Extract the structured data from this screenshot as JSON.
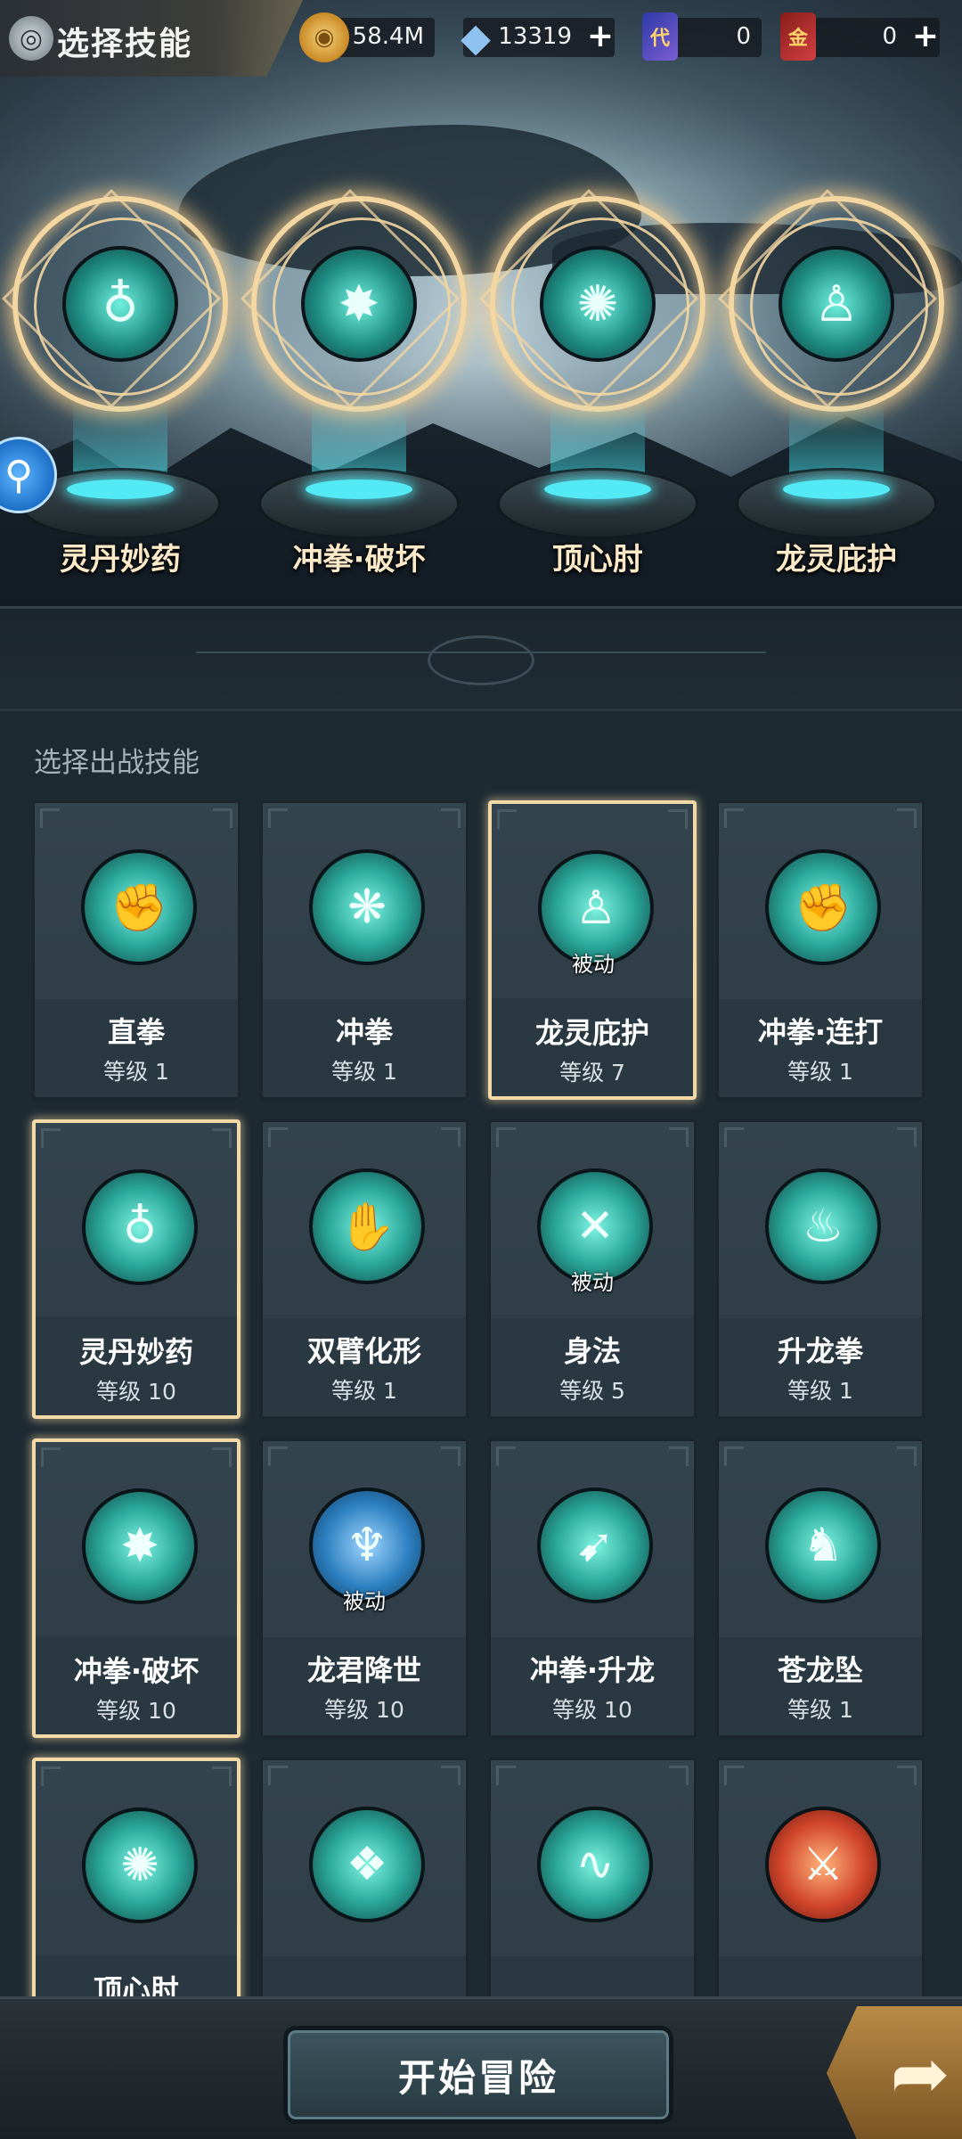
{
  "header": {
    "title": "选择技能",
    "resources": [
      {
        "name": "gold",
        "value": "58.4M",
        "icon": "coin-icon"
      },
      {
        "name": "crystal",
        "value": "13319",
        "icon": "crystal-icon",
        "addable": true
      },
      {
        "name": "token_dai",
        "value": "0",
        "icon_label": "代",
        "icon": "voucher-icon"
      },
      {
        "name": "token_jin",
        "value": "0",
        "icon_label": "金",
        "icon": "gold-voucher-icon",
        "addable": true
      }
    ]
  },
  "equipped": [
    {
      "name": "灵丹妙药",
      "icon": "gourd-icon"
    },
    {
      "name": "冲拳·破坏",
      "icon": "fist-burst-icon"
    },
    {
      "name": "顶心肘",
      "icon": "elbow-strike-icon"
    },
    {
      "name": "龙灵庇护",
      "icon": "dragon-guard-icon"
    }
  ],
  "skills_section": {
    "label": "选择出战技能",
    "skills": [
      {
        "name": "直拳",
        "level": "等级 1",
        "passive": "",
        "selected": false,
        "icon": "straight-punch-icon",
        "glyph": "✊"
      },
      {
        "name": "冲拳",
        "level": "等级 1",
        "passive": "",
        "selected": false,
        "icon": "rush-punch-icon",
        "glyph": "❋"
      },
      {
        "name": "龙灵庇护",
        "level": "等级 7",
        "passive": "被动",
        "selected": true,
        "icon": "dragon-guard-icon",
        "glyph": "♙"
      },
      {
        "name": "冲拳·连打",
        "level": "等级 1",
        "passive": "",
        "selected": false,
        "icon": "combo-punch-icon",
        "glyph": "✊"
      },
      {
        "name": "灵丹妙药",
        "level": "等级 10",
        "passive": "",
        "selected": true,
        "icon": "gourd-icon",
        "glyph": "♁"
      },
      {
        "name": "双臂化形",
        "level": "等级 1",
        "passive": "",
        "selected": false,
        "icon": "twin-arms-icon",
        "glyph": "✋"
      },
      {
        "name": "身法",
        "level": "等级 5",
        "passive": "被动",
        "selected": false,
        "icon": "agility-icon",
        "glyph": "✕"
      },
      {
        "name": "升龙拳",
        "level": "等级 1",
        "passive": "",
        "selected": false,
        "icon": "rising-dragon-icon",
        "glyph": "♨"
      },
      {
        "name": "冲拳·破坏",
        "level": "等级 10",
        "passive": "",
        "selected": true,
        "icon": "fist-burst-icon",
        "glyph": "✸"
      },
      {
        "name": "龙君降世",
        "level": "等级 10",
        "passive": "被动",
        "selected": false,
        "icon": "dragon-lord-icon",
        "glyph": "♆",
        "tone": "blue"
      },
      {
        "name": "冲拳·升龙",
        "level": "等级 10",
        "passive": "",
        "selected": false,
        "icon": "rising-fist-icon",
        "glyph": "➹"
      },
      {
        "name": "苍龙坠",
        "level": "等级 1",
        "passive": "",
        "selected": false,
        "icon": "azure-dragon-icon",
        "glyph": "♞"
      },
      {
        "name": "顶心肘",
        "level": "",
        "passive": "",
        "selected": true,
        "icon": "elbow-strike-icon",
        "glyph": "✺"
      },
      {
        "name": "",
        "level": "",
        "passive": "",
        "selected": false,
        "icon": "dragon-tiger-icon",
        "glyph": "❖"
      },
      {
        "name": "",
        "level": "",
        "passive": "",
        "selected": false,
        "icon": "wandering-dragon-icon",
        "glyph": "∿"
      },
      {
        "name": "",
        "level": "",
        "passive": "",
        "selected": false,
        "icon": "heavy-strike-icon",
        "glyph": "⚔",
        "tone": "red"
      }
    ]
  },
  "footer": {
    "start_label": "开始冒险",
    "next_icon": "arrow-right-icon"
  }
}
